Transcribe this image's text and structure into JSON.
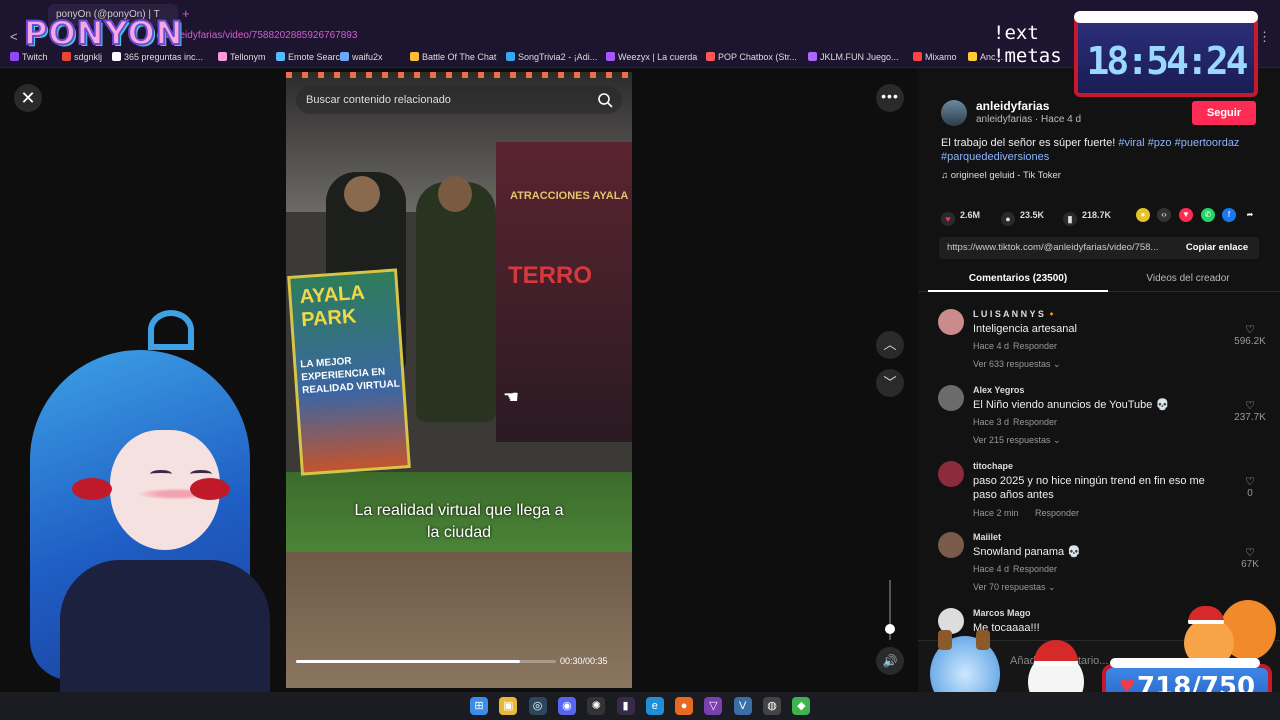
{
  "browser": {
    "tab_title": "ponyOn (@ponyOn) | T",
    "new_tab": "+",
    "back": "<",
    "url": "@anleidyfarias/video/7588202885926767893",
    "menu": "⋮"
  },
  "bookmarks": [
    {
      "label": "Twitch",
      "color": "#9146ff"
    },
    {
      "label": "sdgnklj",
      "color": "#e43"
    },
    {
      "label": "365 preguntas inc...",
      "color": "#fff"
    },
    {
      "label": "Tellonym",
      "color": "#f9d"
    },
    {
      "label": "Emote Search",
      "color": "#5bf"
    },
    {
      "label": "waifu2x",
      "color": "#6af"
    },
    {
      "label": "Battle Of The Chat",
      "color": "#fb3"
    },
    {
      "label": "SongTrivia2 - ¡Adi...",
      "color": "#3ae"
    },
    {
      "label": "Weezyx | La cuerda",
      "color": "#a5f"
    },
    {
      "label": "POP Chatbox (Str...",
      "color": "#f55"
    },
    {
      "label": "JKLM.FUN Juego...",
      "color": "#a6f"
    },
    {
      "label": "Mixamo",
      "color": "#f44"
    },
    {
      "label": "Anc...",
      "color": "#fc3"
    }
  ],
  "video": {
    "search_placeholder": "Buscar contenido relacionado",
    "banner": "ATRACCIONES AYALA",
    "terror": "TERRO",
    "poster_title": "AYALA PARK",
    "poster_sub": "LA MEJOR EXPERIENCIA EN REALIDAD VIRTUAL",
    "caption_line1": "La realidad virtual que llega a",
    "caption_line2": "la ciudad",
    "time": "00:30/00:35",
    "progress": 0.86
  },
  "controls": {
    "close": "✕",
    "more": "•••",
    "up": "︿",
    "down": "﹀",
    "volume": "🔊",
    "volume_level": 0.33
  },
  "author": {
    "name": "anleidyfarias",
    "sub": "anleidyfarias · Hace 4 d",
    "follow": "Seguir",
    "desc_text": "El trabajo del señor es súper fuerte! ",
    "tags": [
      "#viral",
      "#pzo",
      "#puertoordaz",
      "#parquedediversiones"
    ],
    "music": "♫  origineel geluid - Tik Toker"
  },
  "stats": {
    "likes": "2.6M",
    "comments": "23.5K",
    "saves": "218.7K"
  },
  "link": {
    "url": "https://www.tiktok.com/@anleidyfarias/video/758...",
    "copy": "Copiar enlace"
  },
  "tabs": {
    "comments": "Comentarios (23500)",
    "creator": "Videos del creador"
  },
  "comments": [
    {
      "user": "L U I S A N N Y S 🔸",
      "text": "Inteligencia artesanal",
      "time": "Hace 4 d",
      "reply": "Responder",
      "more": "Ver 633 respuestas ⌄",
      "likes": "596.2K",
      "color": "#c98b8b"
    },
    {
      "user": "Alex Yegros",
      "text": "El Niño viendo anuncios de YouTube 💀",
      "time": "Hace 3 d",
      "reply": "Responder",
      "more": "Ver 215 respuestas ⌄",
      "likes": "237.7K",
      "color": "#6b6b6b"
    },
    {
      "user": "titochape",
      "text": "paso 2025 y no hice ningún trend en fin eso me paso años antes",
      "time": "Hace 2 min",
      "reply": "Responder",
      "more": "",
      "likes": "0",
      "color": "#8b2b3b"
    },
    {
      "user": "Maiilet",
      "text": "Snowland panama 💀",
      "time": "Hace 4 d",
      "reply": "Responder",
      "more": "Ver 70 respuestas ⌄",
      "likes": "67K",
      "color": "#7a5a4a"
    },
    {
      "user": "Marcos Mago",
      "text": "Me tocaaaa!!!",
      "time": "",
      "reply": "",
      "more": "",
      "likes": "",
      "color": "#ddd"
    }
  ],
  "comment_input": {
    "placeholder": "Añadir comentario..."
  },
  "stream": {
    "logo": "PONYON",
    "overlay_line1": "!ext",
    "overlay_line2": "!metas",
    "clock": "18:54:24",
    "goal": "718/750",
    "goal_heart": "♥"
  },
  "taskbar": [
    {
      "name": "windows-start-icon",
      "glyph": "⊞",
      "color": "#3b8ee8"
    },
    {
      "name": "file-explorer-icon",
      "glyph": "▣",
      "color": "#e8b73b"
    },
    {
      "name": "steam-icon",
      "glyph": "◎",
      "color": "#2a475e"
    },
    {
      "name": "discord-icon",
      "glyph": "◉",
      "color": "#5865f2"
    },
    {
      "name": "chatgpt-icon",
      "glyph": "✺",
      "color": "#333"
    },
    {
      "name": "obs-icon",
      "glyph": "▮",
      "color": "#3a2a4a"
    },
    {
      "name": "edge-icon",
      "glyph": "e",
      "color": "#1f8fd6"
    },
    {
      "name": "firefox-icon",
      "glyph": "●",
      "color": "#e66a1f"
    },
    {
      "name": "vtube-icon",
      "glyph": "▽",
      "color": "#7a3fb0"
    },
    {
      "name": "vscode-icon",
      "glyph": "V",
      "color": "#3a6ea5"
    },
    {
      "name": "github-icon",
      "glyph": "◍",
      "color": "#444"
    },
    {
      "name": "app-icon",
      "glyph": "◆",
      "color": "#3fb34f"
    }
  ]
}
